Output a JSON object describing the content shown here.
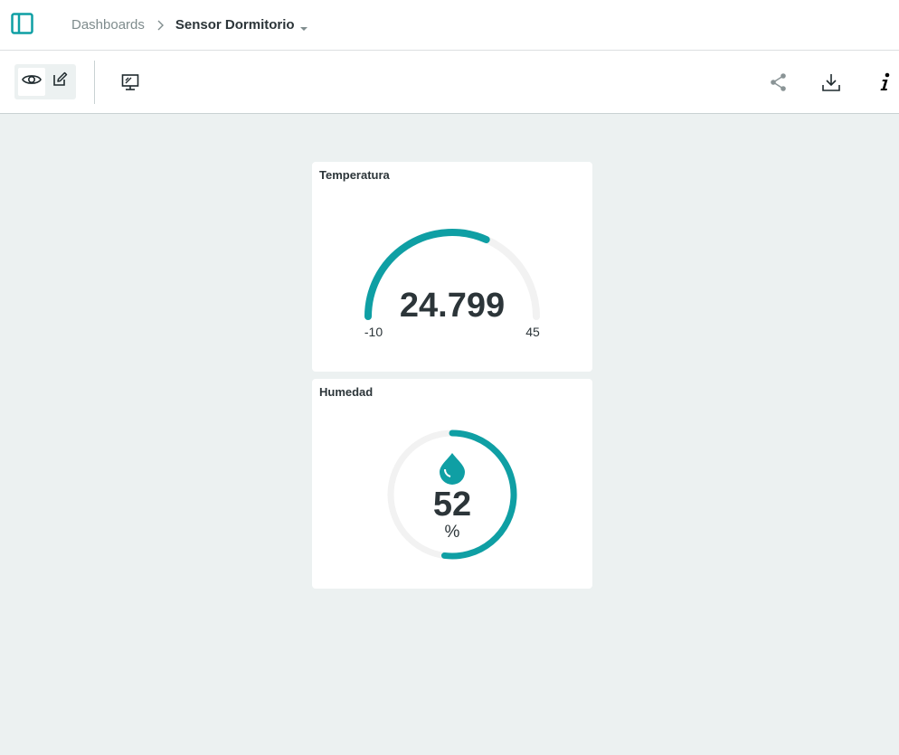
{
  "breadcrumb": {
    "parent": "Dashboards",
    "current": "Sensor Dormitorio"
  },
  "toolbar": {
    "icons": [
      "eye-icon",
      "pencil-icon",
      "monitor-icon",
      "share-icon",
      "download-icon",
      "info-icon"
    ]
  },
  "widgets": {
    "temperature": {
      "title": "Temperatura",
      "value": "24.799",
      "min": "-10",
      "max": "45"
    },
    "humidity": {
      "title": "Humedad",
      "value": "52",
      "unit": "%"
    }
  },
  "colors": {
    "accent": "#0F9FA4",
    "track": "#F2F2F2",
    "text": "#2C3539",
    "background": "#ECF1F1"
  }
}
